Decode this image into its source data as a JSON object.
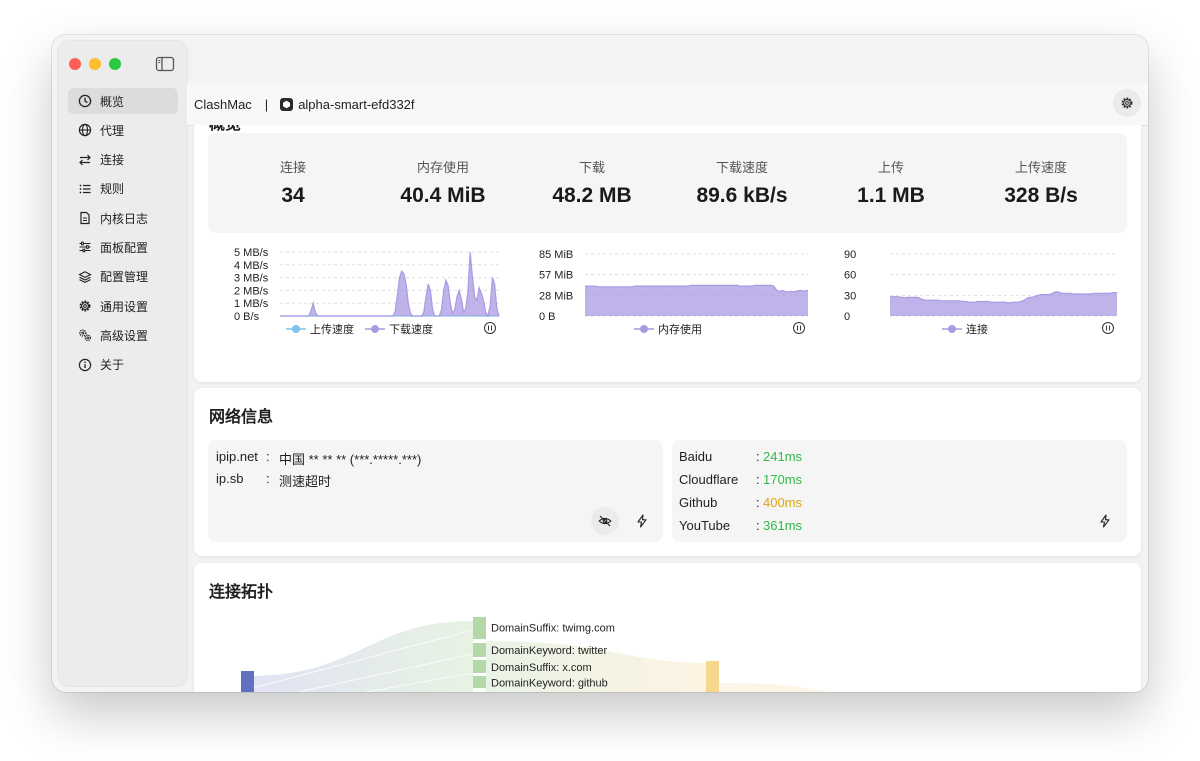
{
  "window": {
    "title": "ClashMac"
  },
  "sidebar": {
    "items": [
      {
        "label": "概览",
        "icon": "clock-icon",
        "active": true
      },
      {
        "label": "代理",
        "icon": "globe-icon"
      },
      {
        "label": "连接",
        "icon": "arrows-swap-icon"
      },
      {
        "label": "规则",
        "icon": "list-icon"
      },
      {
        "label": "内核日志",
        "icon": "document-icon"
      },
      {
        "label": "面板配置",
        "icon": "sliders-icon"
      },
      {
        "label": "配置管理",
        "icon": "layers-icon"
      },
      {
        "label": "通用设置",
        "icon": "gear-icon"
      },
      {
        "label": "高级设置",
        "icon": "gears-icon"
      },
      {
        "label": "关于",
        "icon": "info-icon"
      }
    ]
  },
  "header": {
    "app_name": "ClashMac",
    "separator": "|",
    "profile": "alpha-smart-efd332f"
  },
  "overview": {
    "title": "概览",
    "stats": [
      {
        "label": "连接",
        "value": "34"
      },
      {
        "label": "内存使用",
        "value": "40.4 MiB"
      },
      {
        "label": "下载",
        "value": "48.2 MB"
      },
      {
        "label": "下载速度",
        "value": "89.6 kB/s"
      },
      {
        "label": "上传",
        "value": "1.1 MB"
      },
      {
        "label": "上传速度",
        "value": "328 B/s"
      }
    ]
  },
  "chart_data": [
    {
      "type": "area",
      "yticks": [
        "5 MB/s",
        "4 MB/s",
        "3 MB/s",
        "2 MB/s",
        "1 MB/s",
        "0 B/s"
      ],
      "ylim": [
        0,
        5
      ],
      "legend_position": "bottom",
      "series": [
        {
          "name": "上传速度",
          "color": "#7ec3ee",
          "values": [
            0,
            0,
            0,
            0,
            0,
            0,
            0,
            0,
            0,
            0,
            0,
            0,
            0,
            0,
            0,
            0,
            0,
            0,
            0,
            0,
            0,
            0,
            0,
            0,
            0,
            0,
            0,
            0,
            0,
            0,
            0,
            0,
            0,
            0,
            0,
            0,
            0,
            0,
            0,
            0,
            0,
            0,
            0,
            0,
            0,
            0,
            0,
            0,
            0,
            0,
            0,
            0,
            0,
            0,
            0,
            0,
            0,
            0,
            0,
            0,
            0,
            0,
            0,
            0,
            0,
            0,
            0,
            0,
            0,
            0,
            0,
            0,
            0,
            0,
            0,
            0,
            0,
            0,
            0,
            0,
            0,
            0,
            0,
            0,
            0,
            0,
            0,
            0,
            0,
            0,
            0,
            0,
            0,
            0,
            0,
            0,
            0,
            0,
            0,
            0
          ]
        },
        {
          "name": "下载速度",
          "color": "#a99ae2",
          "values": [
            0,
            0,
            0,
            0,
            0,
            0,
            0,
            0,
            0,
            0,
            0,
            0,
            0,
            0,
            0.4,
            1.0,
            0.3,
            0,
            0,
            0,
            0,
            0,
            0,
            0,
            0,
            0,
            0,
            0,
            0,
            0,
            0,
            0,
            0,
            0,
            0,
            0,
            0,
            0,
            0,
            0,
            0,
            0,
            0,
            0,
            0,
            0,
            0,
            0,
            0,
            0,
            0,
            0,
            0.3,
            1.5,
            3.0,
            3.5,
            3.3,
            2.5,
            1.0,
            0.2,
            0,
            0,
            0,
            0,
            0,
            0.3,
            1.5,
            2.5,
            2.0,
            0.5,
            0,
            0,
            0,
            0.5,
            2.0,
            2.8,
            2.4,
            1.0,
            0.2,
            0.5,
            1.5,
            2.0,
            1.3,
            0.3,
            0.6,
            2.0,
            5.0,
            3.0,
            1.5,
            1.2,
            2.2,
            1.8,
            1.2,
            0.3,
            0,
            0.8,
            3.0,
            2.5,
            0.6,
            0
          ]
        }
      ]
    },
    {
      "type": "area",
      "yticks": [
        "85 MiB",
        "57 MiB",
        "28 MiB",
        "0 B"
      ],
      "ylim": [
        0,
        85
      ],
      "legend_position": "bottom",
      "series": [
        {
          "name": "内存使用",
          "color": "#a99ae2",
          "values": [
            41,
            41,
            41,
            41,
            41,
            41,
            40,
            40,
            40,
            40,
            40,
            40,
            40,
            40,
            40,
            40,
            40,
            40,
            40,
            40,
            40,
            40,
            40,
            41,
            41,
            41,
            41,
            41,
            41,
            41,
            41,
            41,
            41,
            41,
            41,
            41,
            41,
            41,
            41,
            41,
            41,
            41,
            41,
            41,
            41,
            41,
            41,
            41,
            41,
            42,
            42,
            42,
            42,
            42,
            42,
            42,
            42,
            42,
            42,
            42,
            42,
            42,
            42,
            42,
            42,
            42,
            42,
            42,
            42,
            42,
            42,
            42,
            41,
            41,
            41,
            41,
            41,
            41,
            41,
            42,
            42,
            42,
            42,
            42,
            42,
            42,
            42,
            42,
            41,
            37,
            34,
            34,
            35,
            34,
            33,
            33,
            34,
            33,
            34,
            34,
            35,
            35,
            34,
            35,
            35
          ]
        }
      ]
    },
    {
      "type": "area",
      "yticks": [
        "90",
        "60",
        "30",
        "0"
      ],
      "ylim": [
        0,
        90
      ],
      "legend_position": "bottom",
      "series": [
        {
          "name": "连接",
          "color": "#a99ae2",
          "values": [
            28,
            28,
            28,
            28,
            28,
            27,
            27,
            26,
            27,
            27,
            27,
            27,
            27,
            27,
            25,
            24,
            23,
            23,
            23,
            23,
            23,
            23,
            23,
            22,
            22,
            22,
            22,
            22,
            22,
            22,
            22,
            22,
            22,
            21,
            21,
            21,
            20,
            20,
            20,
            20,
            21,
            21,
            21,
            21,
            21,
            21,
            20,
            20,
            20,
            20,
            20,
            20,
            20,
            20,
            19,
            19,
            20,
            20,
            20,
            20,
            21,
            22,
            24,
            26,
            27,
            27,
            28,
            29,
            30,
            31,
            31,
            31,
            31,
            31,
            32,
            34,
            35,
            35,
            34,
            33,
            33,
            33,
            33,
            33,
            32,
            32,
            32,
            32,
            32,
            32,
            32,
            32,
            32,
            33,
            33,
            33,
            33,
            33,
            33,
            33,
            33,
            33,
            34,
            34,
            34
          ]
        }
      ]
    }
  ],
  "network": {
    "title": "网络信息",
    "ip_rows": [
      {
        "name": "ipip.net",
        "colon": ":",
        "value": "中国 ** ** ** (***.*****.***)"
      },
      {
        "name": "ip.sb",
        "colon": ":",
        "value": "测速超时"
      }
    ],
    "latency": [
      {
        "name": "Baidu",
        "colon": ":",
        "value": "241ms",
        "color": "#34b84a"
      },
      {
        "name": "Cloudflare",
        "colon": ":",
        "value": "170ms",
        "color": "#34b84a"
      },
      {
        "name": "Github",
        "colon": ":",
        "value": "400ms",
        "color": "#d9a712"
      },
      {
        "name": "YouTube",
        "colon": ":",
        "value": "361ms",
        "color": "#34b84a"
      }
    ]
  },
  "topology": {
    "title": "连接拓扑",
    "rules": [
      "DomainSuffix: twimg.com",
      "DomainKeyword: twitter",
      "DomainSuffix: x.com",
      "DomainKeyword: github"
    ]
  }
}
